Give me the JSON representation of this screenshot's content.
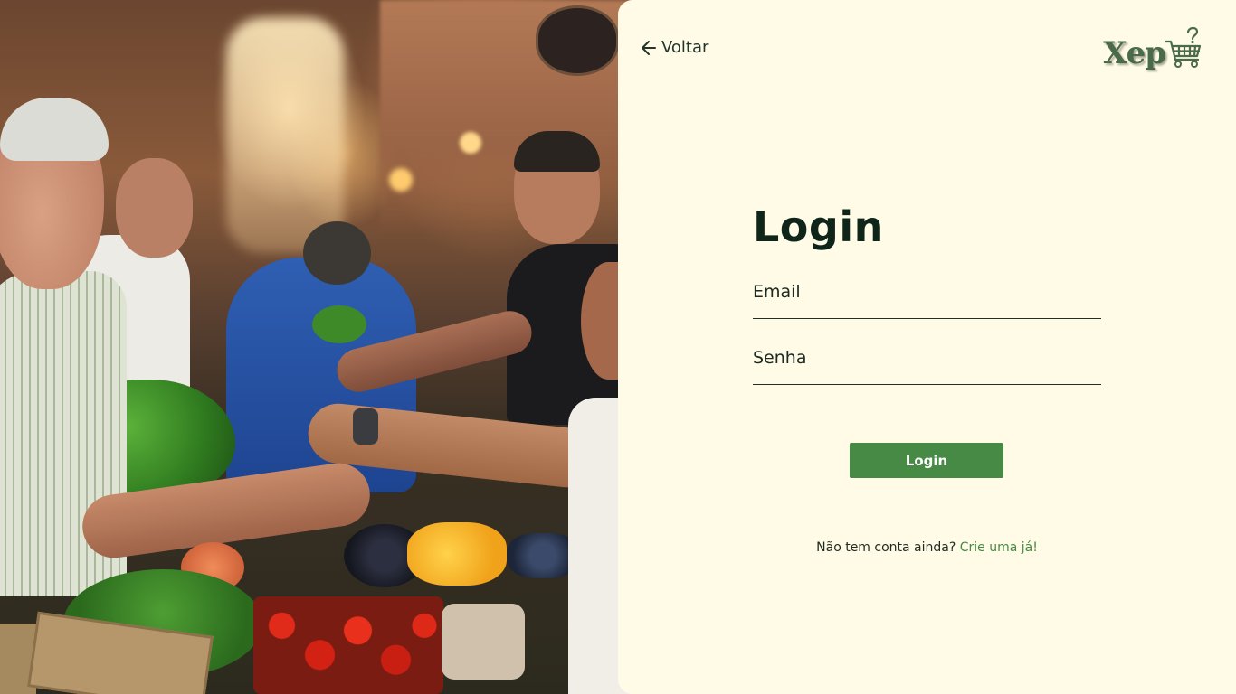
{
  "nav": {
    "back_label": "Voltar"
  },
  "brand": {
    "logo_text": "Xep",
    "icon": "shopping-cart-question-icon",
    "color": "#4a6b4a"
  },
  "hero": {
    "image_description_icon": "market-photo"
  },
  "form": {
    "title": "Login",
    "email_label": "Email",
    "email_value": "",
    "password_label": "Senha",
    "password_value": "",
    "submit_label": "Login"
  },
  "signup": {
    "prompt": "Não tem conta ainda?",
    "link_label": "Crie uma já!"
  },
  "colors": {
    "card_background": "#fffbe6",
    "accent": "#468a45",
    "heading": "#10251a"
  }
}
